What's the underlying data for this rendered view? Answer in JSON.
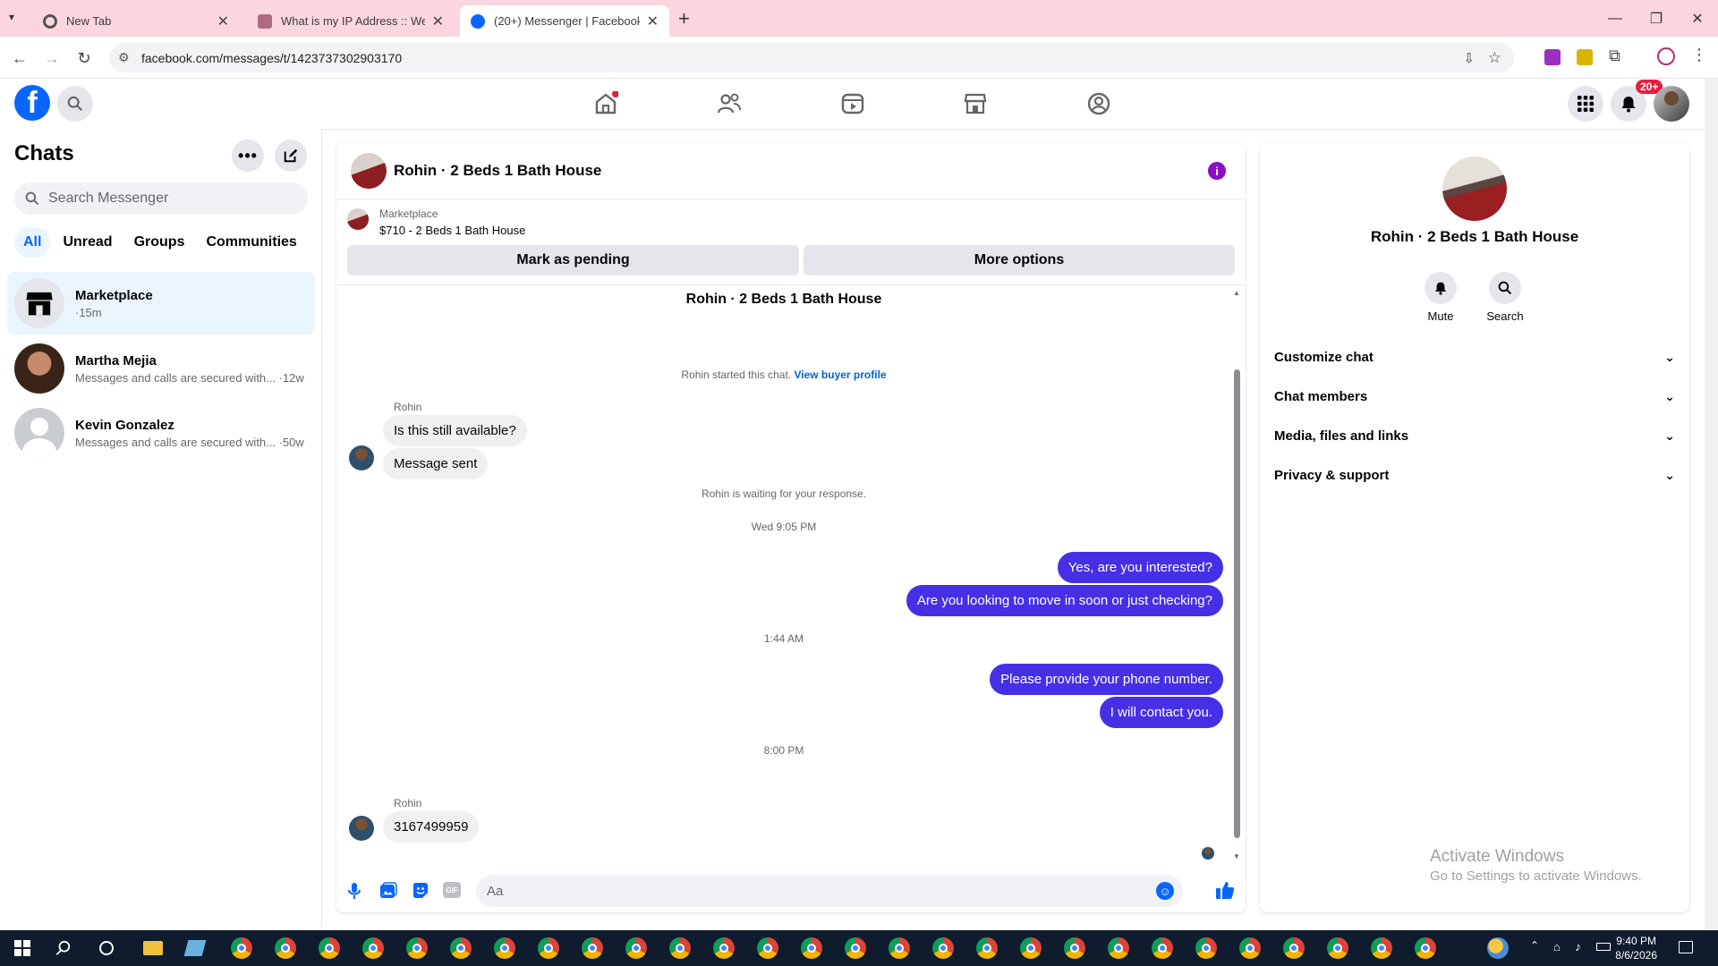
{
  "browser": {
    "tabs": [
      {
        "title": "New Tab",
        "favicon": "chrome-icon"
      },
      {
        "title": "What is my IP Address :: WebBr",
        "favicon": "webbrowser-icon"
      },
      {
        "title": "(20+) Messenger | Facebook",
        "favicon": "facebook-icon",
        "active": true
      }
    ],
    "url": "facebook.com/messages/t/1423737302903170"
  },
  "fb_nav": {
    "notification_badge": "20+",
    "icons": [
      "home-icon",
      "friends-icon",
      "watch-icon",
      "marketplace-icon",
      "gaming-icon"
    ]
  },
  "sidebar": {
    "title": "Chats",
    "search_placeholder": "Search Messenger",
    "filters": [
      "All",
      "Unread",
      "Groups",
      "Communities"
    ],
    "chats": [
      {
        "name": "Marketplace",
        "sub": "·15m"
      },
      {
        "name": "Martha Mejia",
        "sub": "Messages and calls are secured with... ·12w"
      },
      {
        "name": "Kevin Gonzalez",
        "sub": "Messages and calls are secured with... ·50w"
      }
    ]
  },
  "conversation": {
    "title": "Rohin · 2 Beds 1 Bath House",
    "marketplace_label": "Marketplace",
    "listing": "$710 - 2 Beds 1 Bath House",
    "mark_pending": "Mark as pending",
    "more_options": "More options",
    "thread_title": "Rohin · 2 Beds 1 Bath House",
    "started_text": "Rohin started this chat.",
    "view_profile": "View buyer profile",
    "sender_name": "Rohin",
    "messages": [
      {
        "text": "Is this still available?"
      },
      {
        "text": "Message sent"
      },
      {
        "text": "Yes, are you interested?"
      },
      {
        "text": "Are you looking to move in soon or just checking?"
      },
      {
        "text": "Please provide your phone number."
      },
      {
        "text": "I will contact you."
      },
      {
        "text": "3167499959"
      }
    ],
    "waiting_text": "Rohin is waiting for your response.",
    "timestamps": [
      "Wed 9:05 PM",
      "1:44 AM",
      "8:00 PM"
    ],
    "composer_placeholder": "Aa"
  },
  "details": {
    "name": "Rohin · 2 Beds 1 Bath House",
    "actions": [
      "Mute",
      "Search"
    ],
    "sections": [
      "Customize chat",
      "Chat members",
      "Media, files and links",
      "Privacy & support"
    ]
  },
  "watermark": {
    "line1": "Activate Windows",
    "line2": "Go to Settings to activate Windows."
  },
  "taskbar": {
    "time": "9:40 PM",
    "date": "8/6/2026"
  },
  "colors": {
    "brand_blue": "#0866ff",
    "outgoing_bubble": "#4530e6",
    "tab_strip": "#fbd6df"
  }
}
